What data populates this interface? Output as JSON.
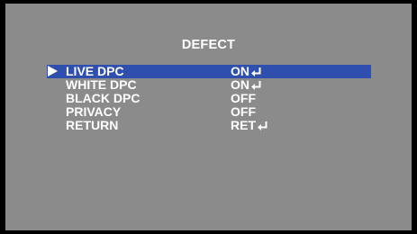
{
  "menu": {
    "title": "DEFECT",
    "items": [
      {
        "label": "LIVE DPC",
        "value": "ON",
        "enter": true,
        "selected": true
      },
      {
        "label": "WHITE DPC",
        "value": "ON",
        "enter": true,
        "selected": false
      },
      {
        "label": "BLACK DPC",
        "value": "OFF",
        "enter": false,
        "selected": false
      },
      {
        "label": "PRIVACY",
        "value": "OFF",
        "enter": false,
        "selected": false
      },
      {
        "label": "RETURN",
        "value": "RET",
        "enter": true,
        "selected": false
      }
    ]
  },
  "colors": {
    "background": "#8b8b8b",
    "highlight": "#2f4fae",
    "text": "#ffffff",
    "border": "#000000"
  },
  "icons": {
    "pointer": "selection-pointer-icon",
    "enter": "enter-return-icon"
  }
}
